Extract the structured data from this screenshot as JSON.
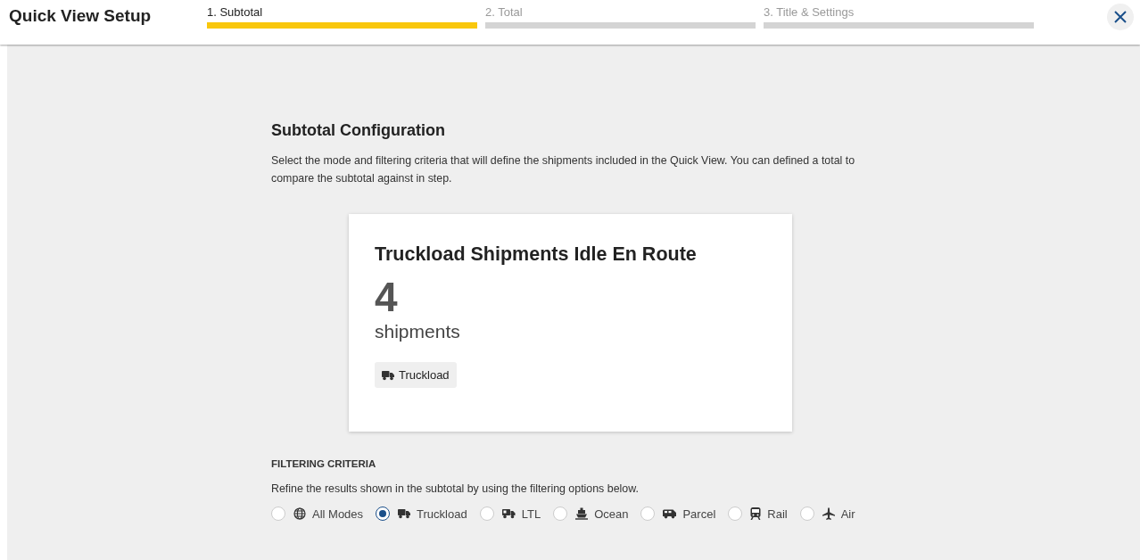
{
  "header": {
    "title": "Quick View Setup",
    "steps": [
      {
        "label": "1. Subtotal",
        "selected": true
      },
      {
        "label": "2. Total",
        "selected": false
      },
      {
        "label": "3. Title & Settings",
        "selected": false
      }
    ]
  },
  "section": {
    "title": "Subtotal Configuration",
    "description": "Select the mode and filtering criteria that will define the shipments included in the Quick View. You can defined a total to compare the subtotal against in step."
  },
  "card": {
    "title": "Truckload Shipments Idle En Route",
    "count": "4",
    "unit": "shipments",
    "tag": {
      "label": "Truckload",
      "kind": "truck"
    }
  },
  "filtering": {
    "heading": "FILTERING CRITERIA",
    "description": "Refine the results shown in the subtotal by using the filtering options below.",
    "modes": [
      {
        "label": "All Modes",
        "kind": "globe",
        "selected": false
      },
      {
        "label": "Truckload",
        "kind": "truck",
        "selected": true
      },
      {
        "label": "LTL",
        "kind": "ltl",
        "selected": false
      },
      {
        "label": "Ocean",
        "kind": "ship",
        "selected": false
      },
      {
        "label": "Parcel",
        "kind": "van",
        "selected": false
      },
      {
        "label": "Rail",
        "kind": "train",
        "selected": false
      },
      {
        "label": "Air",
        "kind": "plane",
        "selected": false
      }
    ]
  }
}
